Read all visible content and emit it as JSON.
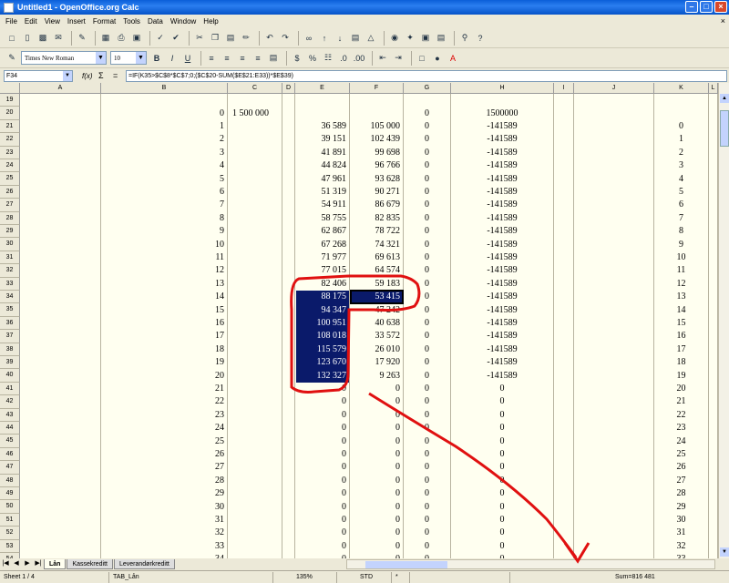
{
  "title": "Untitled1 - OpenOffice.org Calc",
  "menu": [
    "File",
    "Edit",
    "View",
    "Insert",
    "Format",
    "Tools",
    "Data",
    "Window",
    "Help"
  ],
  "font_name": "Times New Roman",
  "font_size": "10",
  "cell_ref": "F34",
  "formula": "=IF(K35>$C$8*$C$7;0;($C$20-SUM($E$21:E33))*$E$39)",
  "columns": [
    "A",
    "B",
    "C",
    "D",
    "E",
    "F",
    "G",
    "H",
    "I",
    "J",
    "K",
    "L"
  ],
  "grid": [
    {
      "r": "19",
      "b": "",
      "c": "",
      "e": "",
      "f": "",
      "g": "",
      "h": "",
      "k": ""
    },
    {
      "r": "20",
      "b": "0",
      "c": "1 500 000",
      "e": "",
      "f": "",
      "g": "0",
      "h": "1500000",
      "k": ""
    },
    {
      "r": "21",
      "b": "1",
      "c": "",
      "e": "36 589",
      "f": "105 000",
      "g": "0",
      "h": "-141589",
      "k": "0"
    },
    {
      "r": "22",
      "b": "2",
      "c": "",
      "e": "39 151",
      "f": "102 439",
      "g": "0",
      "h": "-141589",
      "k": "1"
    },
    {
      "r": "23",
      "b": "3",
      "c": "",
      "e": "41 891",
      "f": "99 698",
      "g": "0",
      "h": "-141589",
      "k": "2"
    },
    {
      "r": "24",
      "b": "4",
      "c": "",
      "e": "44 824",
      "f": "96 766",
      "g": "0",
      "h": "-141589",
      "k": "3"
    },
    {
      "r": "25",
      "b": "5",
      "c": "",
      "e": "47 961",
      "f": "93 628",
      "g": "0",
      "h": "-141589",
      "k": "4"
    },
    {
      "r": "26",
      "b": "6",
      "c": "",
      "e": "51 319",
      "f": "90 271",
      "g": "0",
      "h": "-141589",
      "k": "5"
    },
    {
      "r": "27",
      "b": "7",
      "c": "",
      "e": "54 911",
      "f": "86 679",
      "g": "0",
      "h": "-141589",
      "k": "6"
    },
    {
      "r": "28",
      "b": "8",
      "c": "",
      "e": "58 755",
      "f": "82 835",
      "g": "0",
      "h": "-141589",
      "k": "7"
    },
    {
      "r": "29",
      "b": "9",
      "c": "",
      "e": "62 867",
      "f": "78 722",
      "g": "0",
      "h": "-141589",
      "k": "8"
    },
    {
      "r": "30",
      "b": "10",
      "c": "",
      "e": "67 268",
      "f": "74 321",
      "g": "0",
      "h": "-141589",
      "k": "9"
    },
    {
      "r": "31",
      "b": "11",
      "c": "",
      "e": "71 977",
      "f": "69 613",
      "g": "0",
      "h": "-141589",
      "k": "10"
    },
    {
      "r": "32",
      "b": "12",
      "c": "",
      "e": "77 015",
      "f": "64 574",
      "g": "0",
      "h": "-141589",
      "k": "11"
    },
    {
      "r": "33",
      "b": "13",
      "c": "",
      "e": "82 406",
      "f": "59 183",
      "g": "0",
      "h": "-141589",
      "k": "12"
    },
    {
      "r": "34",
      "b": "14",
      "c": "",
      "e": "88 175",
      "f": "53 415",
      "g": "0",
      "h": "-141589",
      "k": "13"
    },
    {
      "r": "35",
      "b": "15",
      "c": "",
      "e": "94 347",
      "f": "47 242",
      "g": "0",
      "h": "-141589",
      "k": "14"
    },
    {
      "r": "36",
      "b": "16",
      "c": "",
      "e": "100 951",
      "f": "40 638",
      "g": "0",
      "h": "-141589",
      "k": "15"
    },
    {
      "r": "37",
      "b": "17",
      "c": "",
      "e": "108 018",
      "f": "33 572",
      "g": "0",
      "h": "-141589",
      "k": "16"
    },
    {
      "r": "38",
      "b": "18",
      "c": "",
      "e": "115 579",
      "f": "26 010",
      "g": "0",
      "h": "-141589",
      "k": "17"
    },
    {
      "r": "39",
      "b": "19",
      "c": "",
      "e": "123 670",
      "f": "17 920",
      "g": "0",
      "h": "-141589",
      "k": "18"
    },
    {
      "r": "40",
      "b": "20",
      "c": "",
      "e": "132 327",
      "f": "9 263",
      "g": "0",
      "h": "-141589",
      "k": "19"
    },
    {
      "r": "41",
      "b": "21",
      "c": "",
      "e": "0",
      "f": "0",
      "g": "0",
      "h": "0",
      "k": "20"
    },
    {
      "r": "42",
      "b": "22",
      "c": "",
      "e": "0",
      "f": "0",
      "g": "0",
      "h": "0",
      "k": "21"
    },
    {
      "r": "43",
      "b": "23",
      "c": "",
      "e": "0",
      "f": "0",
      "g": "0",
      "h": "0",
      "k": "22"
    },
    {
      "r": "44",
      "b": "24",
      "c": "",
      "e": "0",
      "f": "0",
      "g": "0",
      "h": "0",
      "k": "23"
    },
    {
      "r": "45",
      "b": "25",
      "c": "",
      "e": "0",
      "f": "0",
      "g": "0",
      "h": "0",
      "k": "24"
    },
    {
      "r": "46",
      "b": "26",
      "c": "",
      "e": "0",
      "f": "0",
      "g": "0",
      "h": "0",
      "k": "25"
    },
    {
      "r": "47",
      "b": "27",
      "c": "",
      "e": "0",
      "f": "0",
      "g": "0",
      "h": "0",
      "k": "26"
    },
    {
      "r": "48",
      "b": "28",
      "c": "",
      "e": "0",
      "f": "0",
      "g": "0",
      "h": "0",
      "k": "27"
    },
    {
      "r": "49",
      "b": "29",
      "c": "",
      "e": "0",
      "f": "0",
      "g": "0",
      "h": "0",
      "k": "28"
    },
    {
      "r": "50",
      "b": "30",
      "c": "",
      "e": "0",
      "f": "0",
      "g": "0",
      "h": "0",
      "k": "29"
    },
    {
      "r": "51",
      "b": "31",
      "c": "",
      "e": "0",
      "f": "0",
      "g": "0",
      "h": "0",
      "k": "30"
    },
    {
      "r": "52",
      "b": "32",
      "c": "",
      "e": "0",
      "f": "0",
      "g": "0",
      "h": "0",
      "k": "31"
    },
    {
      "r": "53",
      "b": "33",
      "c": "",
      "e": "0",
      "f": "0",
      "g": "0",
      "h": "0",
      "k": "32"
    },
    {
      "r": "54",
      "b": "34",
      "c": "",
      "e": "0",
      "f": "0",
      "g": "0",
      "h": "0",
      "k": "33"
    }
  ],
  "tabs": [
    "Lån",
    "Kassekreditt",
    "Leverandørkreditt"
  ],
  "status": {
    "sheet": "Sheet 1 / 4",
    "page_style": "TAB_Lån",
    "zoom": "135%",
    "mode": "STD",
    "modified": "*",
    "sum": "Sum=816 481"
  },
  "colors": {
    "sheet_bg": "#fffff0",
    "selection": "#0a1a6a",
    "annotation": "#e01010",
    "title_blue": "#0a5ed8"
  }
}
